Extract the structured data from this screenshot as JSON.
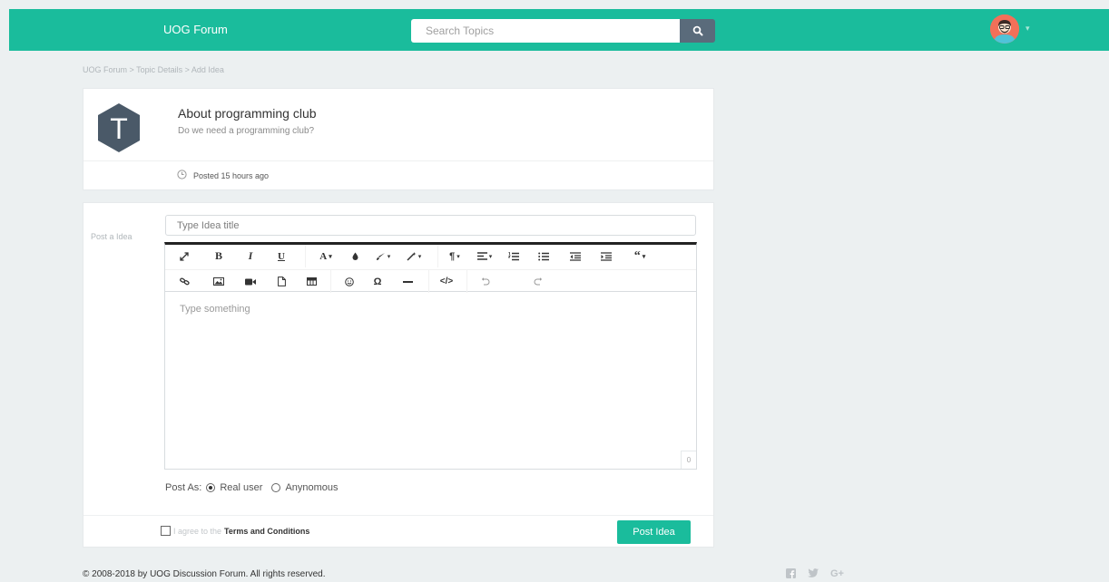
{
  "header": {
    "brand": "UOG Forum",
    "search_placeholder": "Search Topics"
  },
  "breadcrumb": "UOG Forum > Topic Details > Add Idea",
  "topic": {
    "avatar_letter": "T",
    "title": "About programming club",
    "description": "Do we need a programming club?",
    "posted": "Posted 15 hours ago"
  },
  "post_form": {
    "label": "Post a Idea",
    "title_placeholder": "Type Idea title",
    "editor_placeholder": "Type something",
    "char_count": "0",
    "post_as_label": "Post As:",
    "options": [
      "Real user",
      "Anynomous"
    ],
    "selected_option": "Real user",
    "agree_text": "I agree to the",
    "terms_text": "Terms and Conditions",
    "submit_label": "Post Idea"
  },
  "toolbar": {
    "row1": [
      "expand-icon",
      "bold-icon",
      "italic-icon",
      "underline-icon",
      "font-color-icon",
      "paint-drop-icon",
      "brush-icon",
      "magic-wand-icon",
      "paragraph-icon",
      "align-icon",
      "ordered-list-icon",
      "unordered-list-icon",
      "outdent-icon",
      "indent-icon",
      "quote-icon"
    ],
    "row2": [
      "link-icon",
      "image-icon",
      "video-icon",
      "file-icon",
      "table-icon",
      "emoji-icon",
      "omega-icon",
      "horizontal-rule-icon",
      "code-icon",
      "undo-icon",
      "redo-icon"
    ]
  },
  "footer": {
    "copyright": "© 2008-2018 by UOG Discussion Forum. All rights reserved."
  },
  "colors": {
    "accent": "#1abc9c",
    "search_button": "#5a6b7b",
    "hex_avatar": "#4a5968",
    "background": "#ecf0f1"
  }
}
